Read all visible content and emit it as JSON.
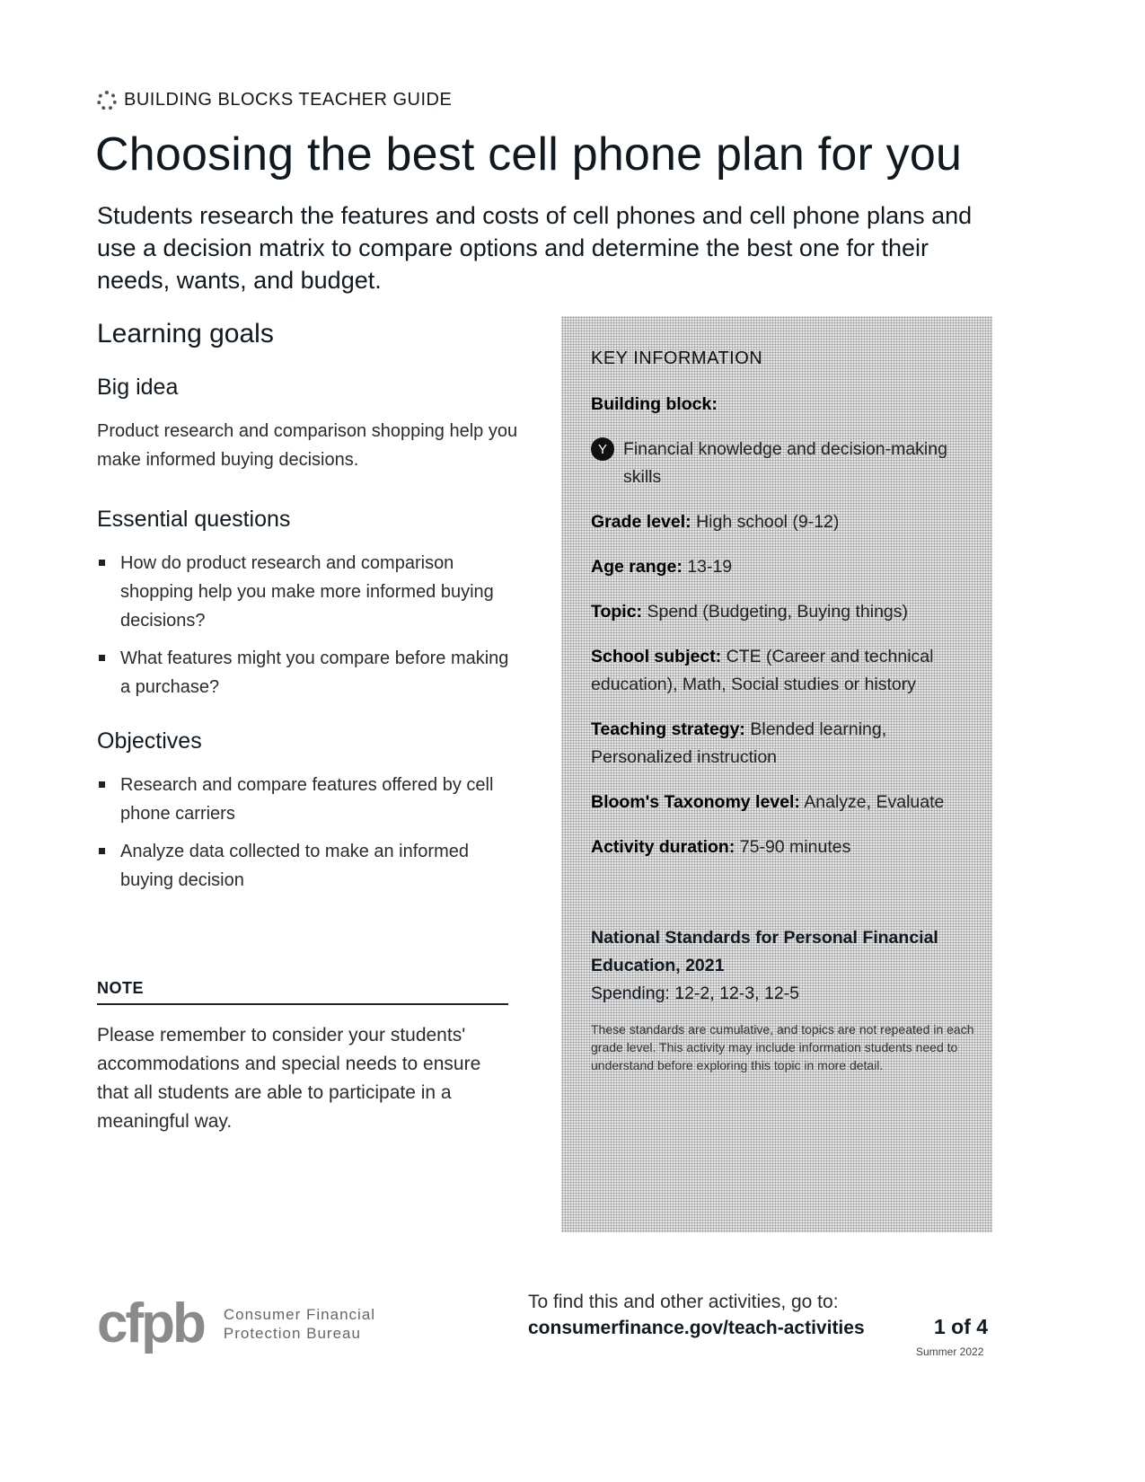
{
  "header": {
    "kicker": "BUILDING BLOCKS TEACHER GUIDE",
    "kicker_icon": "building-blocks-logo-icon",
    "title": "Choosing the best cell phone plan for you",
    "lede": "Students research the features and costs of cell phones and cell phone plans and use a decision matrix to compare options and determine the best one for their needs, wants, and budget."
  },
  "learning_goals": {
    "heading": "Learning goals",
    "big_idea": {
      "heading": "Big idea",
      "text": "Product research and comparison shopping help you make informed buying decisions."
    },
    "essential_questions": {
      "heading": "Essential questions",
      "items": [
        "How do product research and comparison shopping help you make more informed buying decisions?",
        "What features might you compare before making a purchase?"
      ]
    },
    "objectives": {
      "heading": "Objectives",
      "items": [
        "Research and compare features offered by cell phone carriers",
        "Analyze data collected to make an informed buying decision"
      ]
    }
  },
  "note": {
    "label": "NOTE",
    "text": "Please remember to consider your students' accommodations and special needs to ensure that all students are able to participate in a meaningful way."
  },
  "key_information": {
    "heading": "KEY INFORMATION",
    "building_block_label": "Building block:",
    "building_block_icon": "branching-path-icon",
    "building_block_value": "Financial knowledge and decision-making skills",
    "fields": [
      {
        "label": "Grade level:",
        "value": "High school (9-12)"
      },
      {
        "label": "Age range:",
        "value": "13-19"
      },
      {
        "label": "Topic:",
        "value": "Spend (Budgeting, Buying things)"
      },
      {
        "label": "School subject:",
        "value": "CTE (Career and technical education), Math, Social studies or history"
      },
      {
        "label": "Teaching strategy:",
        "value": "Blended learning, Personalized instruction"
      },
      {
        "label": "Bloom's Taxonomy level:",
        "value": "Analyze, Evaluate"
      },
      {
        "label": "Activity duration:",
        "value": "75-90 minutes"
      }
    ],
    "standards": {
      "title": "National Standards for Personal Financial Education, 2021",
      "value": "Spending: 12-2, 12-3, 12-5",
      "note": "These standards are cumulative, and topics are not repeated in each grade level. This activity may include information students need to understand before exploring this topic in more detail."
    }
  },
  "footer": {
    "logo_mark": "cfpb",
    "logo_line1": "Consumer Financial",
    "logo_line2": "Protection Bureau",
    "lead": "To find this and other activities, go to:",
    "link": "consumerfinance.gov/teach-activities",
    "page": "1 of 4",
    "season": "Summer 2022"
  }
}
